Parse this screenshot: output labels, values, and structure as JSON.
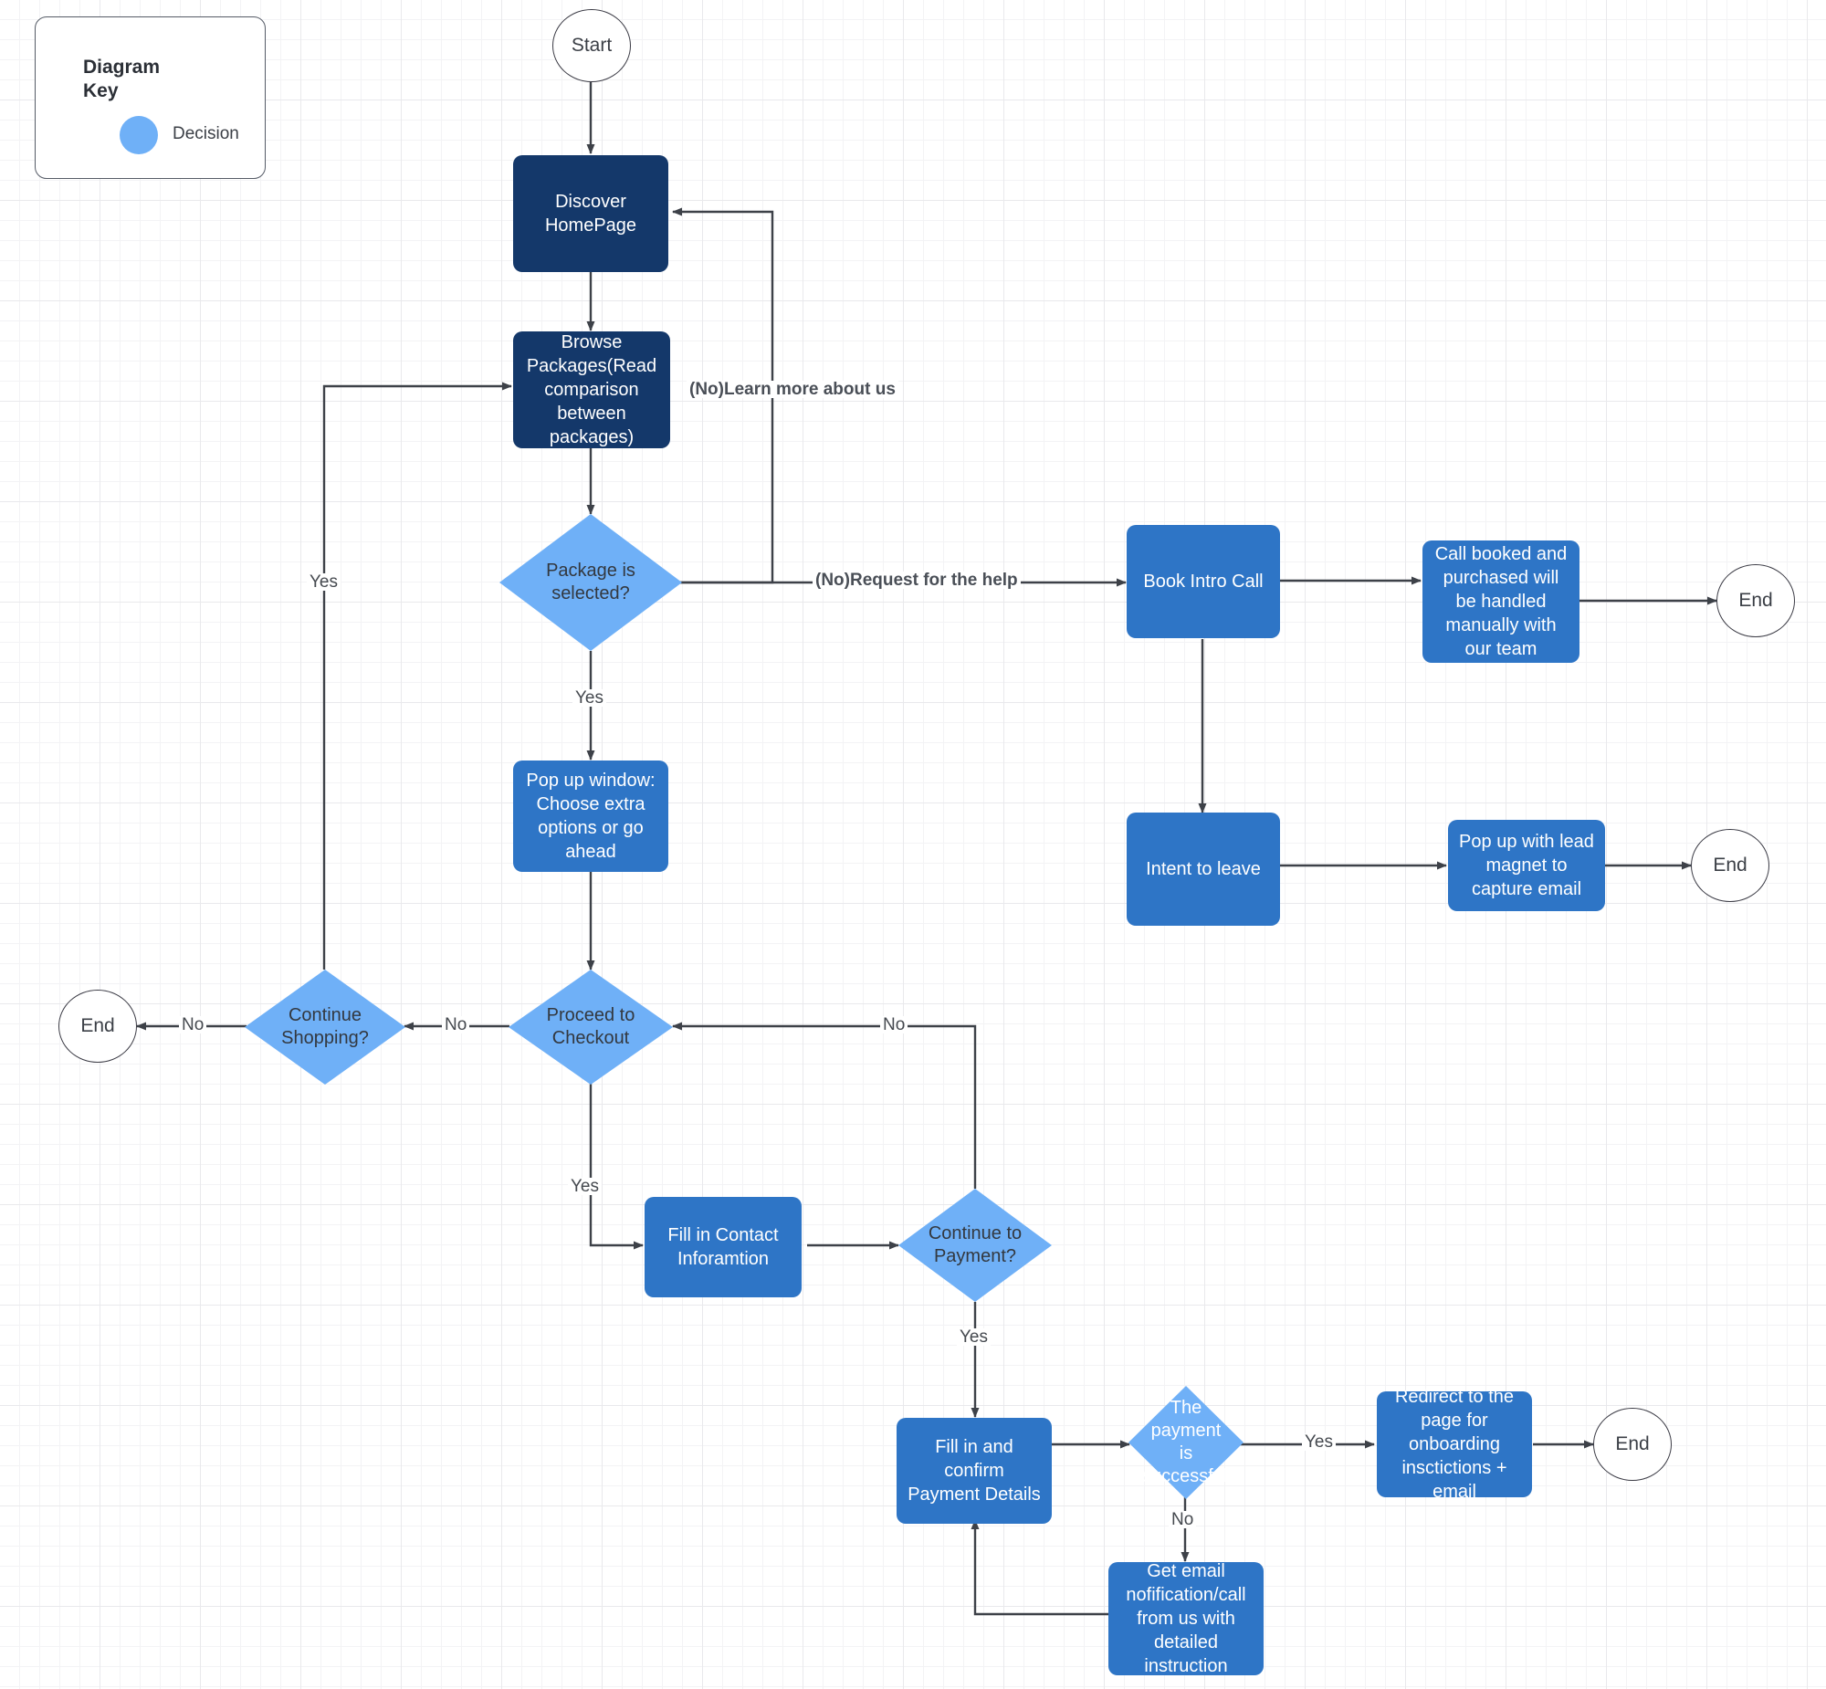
{
  "legend": {
    "title": "Diagram Key",
    "items": [
      {
        "shape": "circle",
        "color": "#6fb0f7",
        "label": "Decision"
      }
    ]
  },
  "palette": {
    "navy_process": "#14386a",
    "blue_process": "#2e75c6",
    "decision": "#6fb0f7",
    "terminal_fill": "#ffffff",
    "terminal_stroke": "#3a3a44",
    "edge": "#3d4148",
    "grid_minor": "#f3f3f5",
    "grid_major": "#e9e9ec"
  },
  "nodes": {
    "start": {
      "label": "Start",
      "type": "terminal"
    },
    "discover_homepage": {
      "label": "Discover HomePage",
      "type": "process-navy"
    },
    "browse_packages": {
      "label": "Browse Packages(Read comparison between packages)",
      "type": "process-navy"
    },
    "package_selected": {
      "label": "Package is selected?",
      "type": "decision"
    },
    "popup_window": {
      "label": "Pop up window: Choose extra options or go ahead",
      "type": "process-blue"
    },
    "book_intro_call": {
      "label": "Book Intro Call",
      "type": "process-blue"
    },
    "call_booked": {
      "label": "Call booked and purchased will be handled manually with our team",
      "type": "process-blue"
    },
    "end_1": {
      "label": "End",
      "type": "terminal"
    },
    "intent_to_leave": {
      "label": "Intent to leave",
      "type": "process-blue"
    },
    "lead_magnet": {
      "label": "Pop up with lead magnet to capture email",
      "type": "process-blue"
    },
    "end_2": {
      "label": "End",
      "type": "terminal"
    },
    "continue_shopping": {
      "label": "Continue Shopping?",
      "type": "decision"
    },
    "proceed_checkout": {
      "label": "Proceed to Checkout",
      "type": "decision"
    },
    "end_3": {
      "label": "End",
      "type": "terminal"
    },
    "fill_contact": {
      "label": "Fill in Contact Inforamtion",
      "type": "process-blue"
    },
    "continue_payment": {
      "label": "Continue to Payment?",
      "type": "decision"
    },
    "fill_payment": {
      "label": "Fill in and confirm Payment Details",
      "type": "process-blue"
    },
    "payment_successful": {
      "label": "The payment is successful?",
      "type": "decision"
    },
    "redirect_onboarding": {
      "label": "Redirect to the page for onboarding insctictions + email",
      "type": "process-blue"
    },
    "end_4": {
      "label": "End",
      "type": "terminal"
    },
    "get_email_notification": {
      "label": "Get email nofification/call from us with detailed instruction",
      "type": "process-blue"
    }
  },
  "edge_labels": {
    "learn_more": "(No)Learn more about us",
    "request_help": "(No)Request for the help",
    "pkg_yes": "Yes",
    "shop_yes": "Yes",
    "shop_no": "No",
    "checkout_no": "No",
    "checkout_yes": "Yes",
    "payment_back_no": "No",
    "payment_yes": "Yes",
    "success_yes": "Yes",
    "success_no": "No"
  }
}
